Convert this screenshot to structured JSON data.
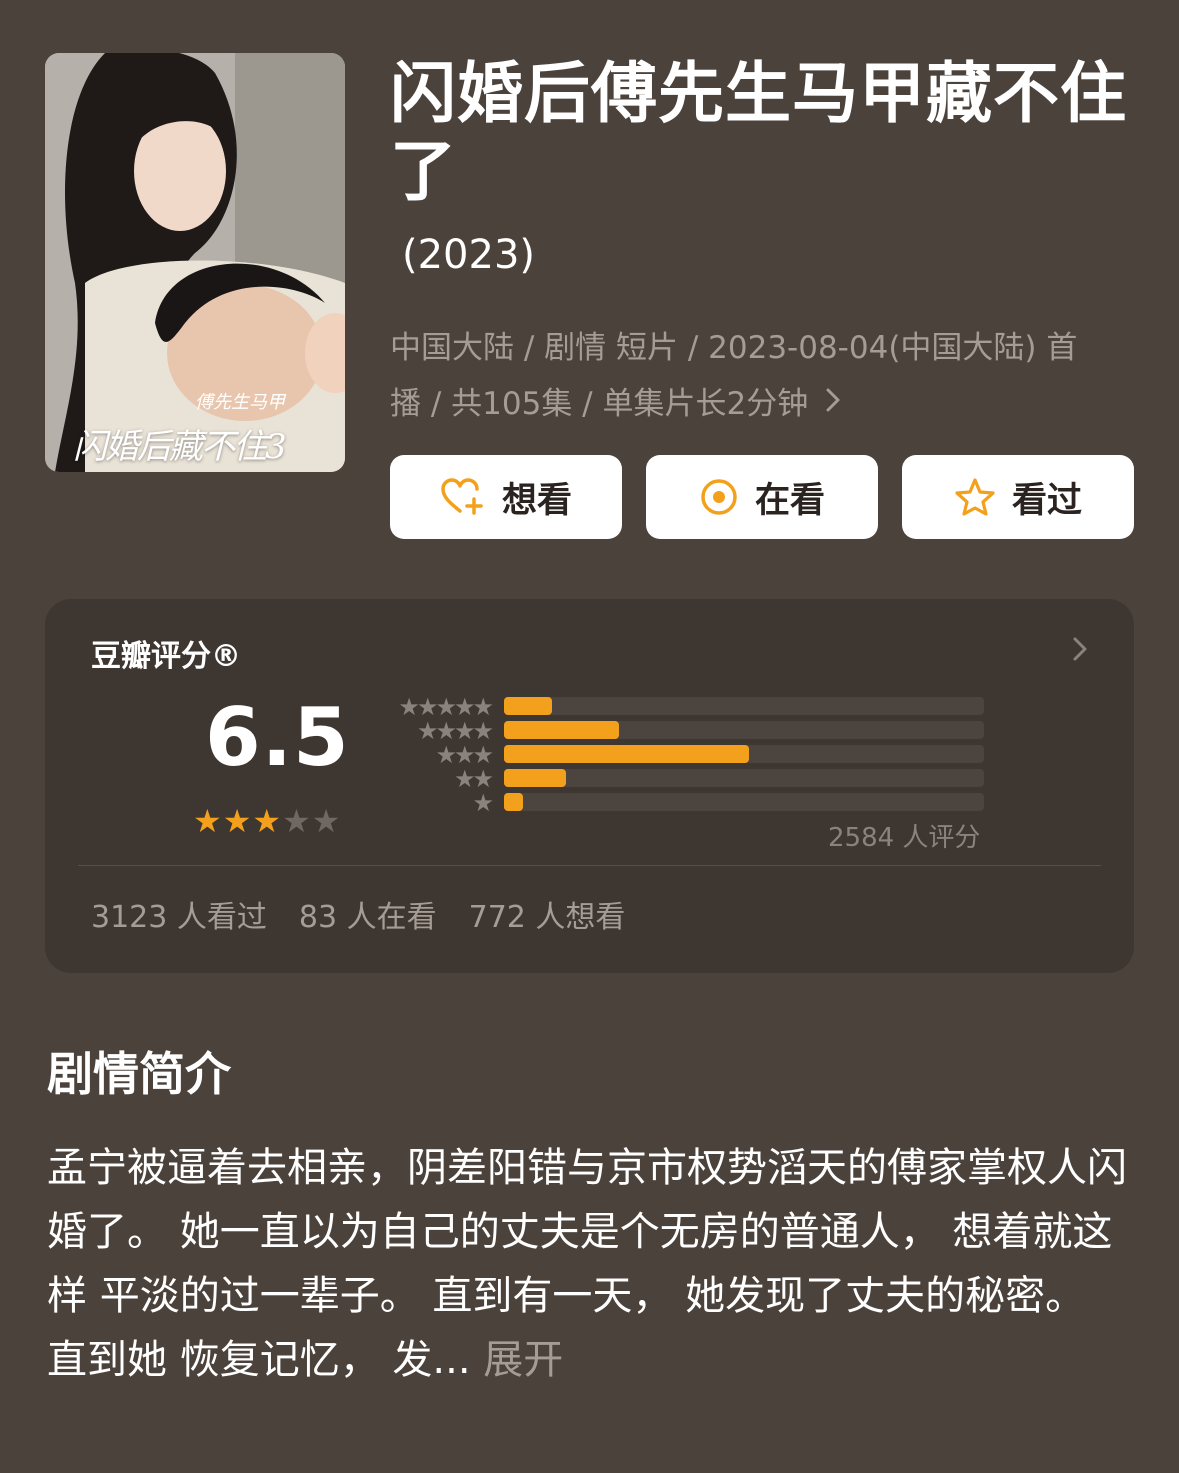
{
  "poster": {
    "caption_main": "闪婚后",
    "caption_side": "傅先生马甲",
    "caption_end": "藏不住3"
  },
  "title": "闪婚后傅先生马甲藏不住了",
  "year": "(2023)",
  "meta": {
    "line1": "中国大陆 / 剧情 短片 / 2023-08-04(中国大陆) 首",
    "line2": "播 / 共105集 / 单集片长2分钟"
  },
  "actions": {
    "want_label": "想看",
    "watching_label": "在看",
    "watched_label": "看过"
  },
  "rating": {
    "label": "豆瓣评分®",
    "score": "6.5",
    "stars_filled": 3,
    "stars_total": 5,
    "distribution": [
      {
        "stars": "★★★★★",
        "fraction": 0.1
      },
      {
        "stars": "★★★★",
        "fraction": 0.24
      },
      {
        "stars": "★★★",
        "fraction": 0.51
      },
      {
        "stars": "★★",
        "fraction": 0.13
      },
      {
        "stars": "★",
        "fraction": 0.04
      }
    ],
    "count_label": "2584 人评分",
    "stats": [
      "3123 人看过",
      "83 人在看",
      "772 人想看"
    ]
  },
  "synopsis": {
    "heading": "剧情简介",
    "text": "孟宁被逼着去相亲，阴差阳错与京市权势滔天的傅家掌权人闪 婚了。 她一直以为自己的丈夫是个无房的普通人， 想着就这样 平淡的过一辈子。 直到有一天， 她发现了丈夫的秘密。 直到她 恢复记忆， 发...",
    "more_label": "展开"
  },
  "colors": {
    "background": "#4b423c",
    "card": "#3e3631",
    "accent": "#f3a01c",
    "muted_text": "#a59c95"
  }
}
